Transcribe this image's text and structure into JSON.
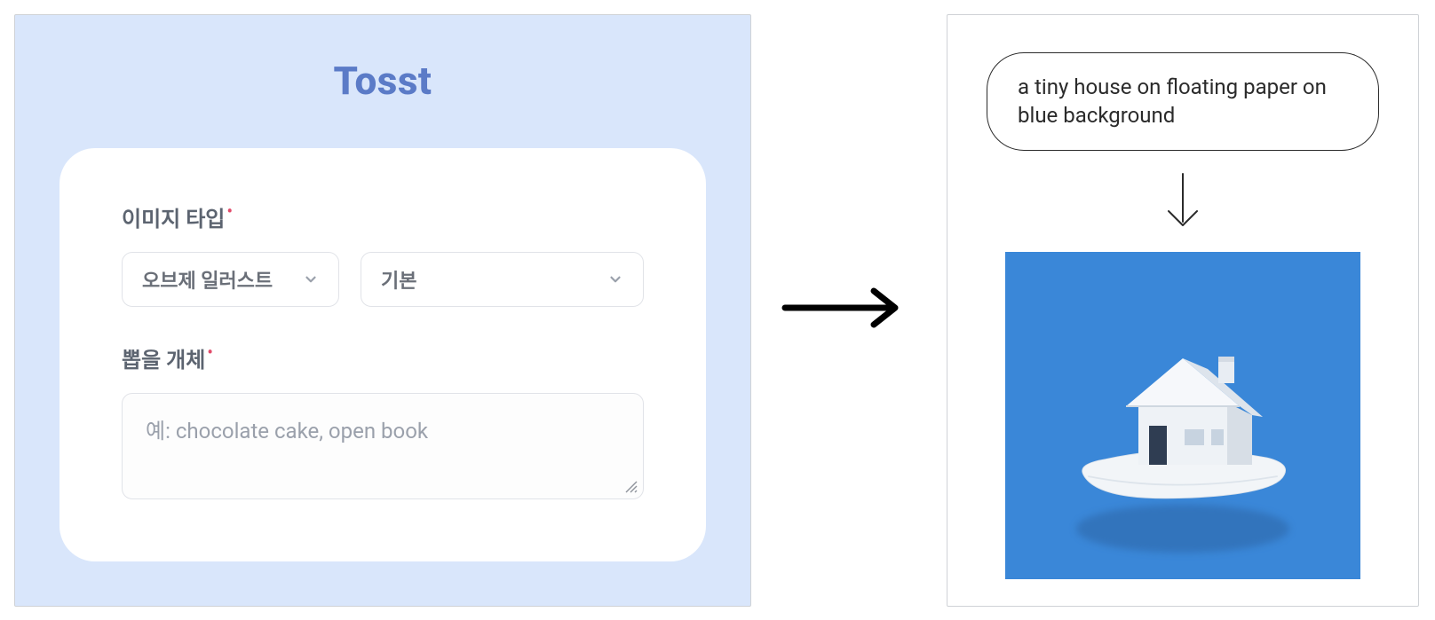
{
  "left": {
    "brand": "Tosst",
    "field_image_type_label": "이미지 타입",
    "select_primary": "오브제 일러스트",
    "select_secondary": "기본",
    "field_object_label": "뽑을 개체",
    "textarea_placeholder": "예: chocolate cake, open book"
  },
  "right": {
    "prompt_text": "a tiny house on floating paper on blue background",
    "image_alt": "Rendered image: tiny white house on floating white paper over blue background"
  },
  "icons": {
    "chevron_down": "chevron-down-icon",
    "arrow_right": "arrow-right-icon",
    "arrow_down": "arrow-down-icon",
    "required_dot": "required-dot-icon"
  },
  "colors": {
    "panel_bg": "#d9e6fb",
    "brand_text": "#5b7bc7",
    "output_bg": "#3a87d8",
    "border": "#cfd2d6",
    "text_muted": "#6a6f78",
    "required": "#e24b6a"
  }
}
